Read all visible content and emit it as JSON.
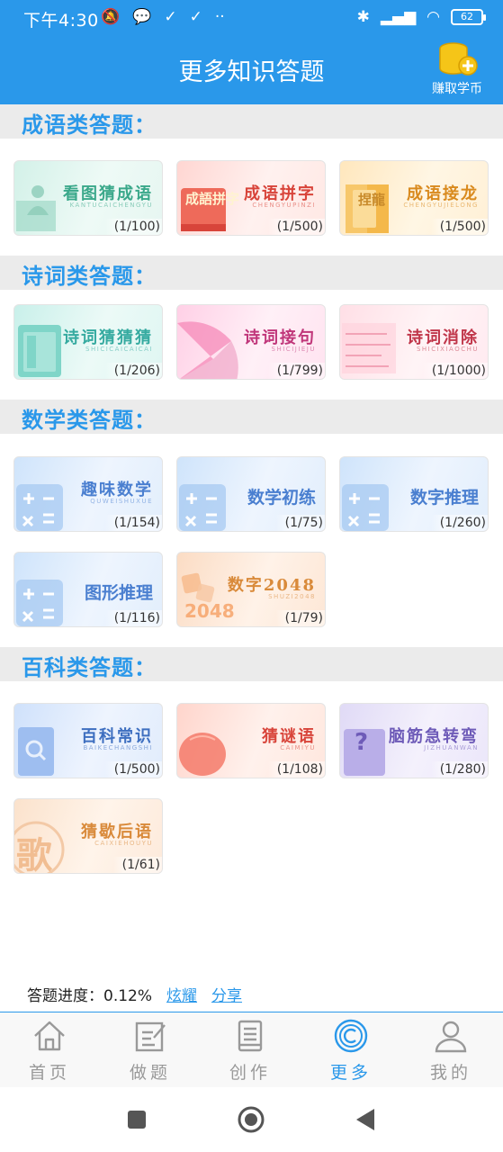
{
  "status_bar": {
    "time": "下午4:30",
    "battery": "62"
  },
  "header": {
    "title": "更多知识答题",
    "earn_label": "赚取学币"
  },
  "sections": [
    {
      "title": "成语类答题：",
      "cards": [
        {
          "title": "看图猜成语",
          "subtitle": "KANTUCAICHENGYU",
          "count": "(1/100)"
        },
        {
          "title": "成语拼字",
          "subtitle": "CHENGYUPINZI",
          "count": "(1/500)"
        },
        {
          "title": "成语接龙",
          "subtitle": "CHENGYUJIELONG",
          "count": "(1/500)"
        }
      ]
    },
    {
      "title": "诗词类答题：",
      "cards": [
        {
          "title": "诗词猜猜猜",
          "subtitle": "SHICICAICAICAI",
          "count": "(1/206)"
        },
        {
          "title": "诗词接句",
          "subtitle": "SHICIJIEJU",
          "count": "(1/799)"
        },
        {
          "title": "诗词消除",
          "subtitle": "SHICIXIAOCHU",
          "count": "(1/1000)"
        }
      ]
    },
    {
      "title": "数学类答题：",
      "cards": [
        {
          "title": "趣味数学",
          "subtitle": "QUWEISHUXUE",
          "count": "(1/154)"
        },
        {
          "title": "数学初练",
          "subtitle": "",
          "count": "(1/75)"
        },
        {
          "title": "数字推理",
          "subtitle": "",
          "count": "(1/260)"
        },
        {
          "title": "图形推理",
          "subtitle": "",
          "count": "(1/116)"
        },
        {
          "title": "数字2048",
          "subtitle": "SHUZI2048",
          "count": "(1/79)"
        }
      ]
    },
    {
      "title": "百科类答题：",
      "cards": [
        {
          "title": "百科常识",
          "subtitle": "BAIKECHANGSHI",
          "count": "(1/500)"
        },
        {
          "title": "猜谜语",
          "subtitle": "CAIMIYU",
          "count": "(1/108)"
        },
        {
          "title": "脑筋急转弯",
          "subtitle": "JIZHUANWAN",
          "count": "(1/280)"
        },
        {
          "title": "猜歇后语",
          "subtitle": "CAIXIEHOUYU",
          "count": "(1/61)"
        }
      ]
    }
  ],
  "card_art_text": {
    "pinzi": "成語拼字",
    "jielong": "捏龍",
    "num2048": "2048",
    "ge": "歌",
    "question": "?"
  },
  "progress": {
    "label": "答题进度：0.12%",
    "show_off": "炫耀",
    "share": "分享"
  },
  "tabs": [
    {
      "label": "首页",
      "icon": "home-icon"
    },
    {
      "label": "做题",
      "icon": "edit-icon"
    },
    {
      "label": "创作",
      "icon": "document-icon"
    },
    {
      "label": "更多",
      "icon": "more-icon",
      "active": true
    },
    {
      "label": "我的",
      "icon": "user-icon"
    }
  ],
  "colors": {
    "accent": "#2a98ea",
    "idiom_green": "#3aa88a",
    "idiom_red": "#d8443a",
    "idiom_orange": "#d98a1e",
    "poetry_teal": "#35aaa0",
    "poetry_pink": "#c0367a",
    "math_blue": "#4a7fd0",
    "math_orange": "#d98a3a"
  }
}
